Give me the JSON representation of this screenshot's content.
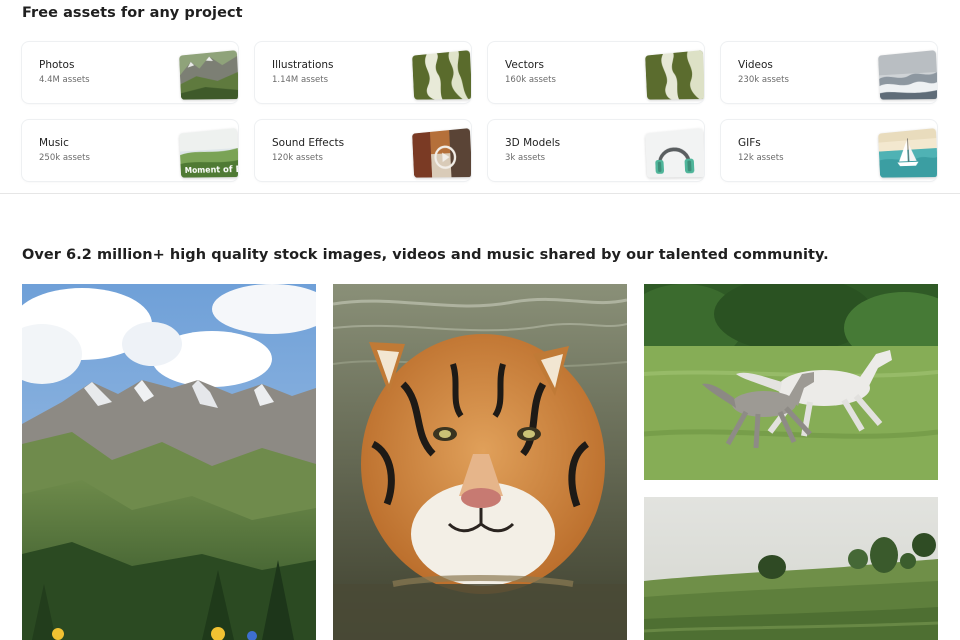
{
  "section_title": "Free assets for any project",
  "categories": [
    {
      "label": "Photos",
      "count": "4.4M assets",
      "icon": "mountain-landscape-thumbnail"
    },
    {
      "label": "Illustrations",
      "count": "1.14M assets",
      "icon": "green-abstract-illustration-thumbnail"
    },
    {
      "label": "Vectors",
      "count": "160k assets",
      "icon": "green-abstract-vector-thumbnail"
    },
    {
      "label": "Videos",
      "count": "230k assets",
      "icon": "ocean-wave-video-thumbnail"
    },
    {
      "label": "Music",
      "count": "250k assets",
      "icon": "music-cover-thumbnail"
    },
    {
      "label": "Sound Effects",
      "count": "120k assets",
      "icon": "sound-effects-thumbnail"
    },
    {
      "label": "3D Models",
      "count": "3k assets",
      "icon": "headphones-3d-thumbnail"
    },
    {
      "label": "GIFs",
      "count": "12k assets",
      "icon": "sailboat-gif-thumbnail"
    }
  ],
  "music_thumb_text": "Moment of Pe",
  "headline": "Over 6.2 million+ high quality stock images, videos and music shared by our talented community.",
  "photos": [
    {
      "subject": "mountain-landscape-photo"
    },
    {
      "subject": "tiger-in-water-photo"
    },
    {
      "subject": "running-horses-photo"
    },
    {
      "subject": "green-field-photo"
    }
  ],
  "colors": {
    "text": "#1f1f1f",
    "muted": "#6b6b6b",
    "divider": "#e6e6e6",
    "illustration_green": "#5a6b2c"
  }
}
